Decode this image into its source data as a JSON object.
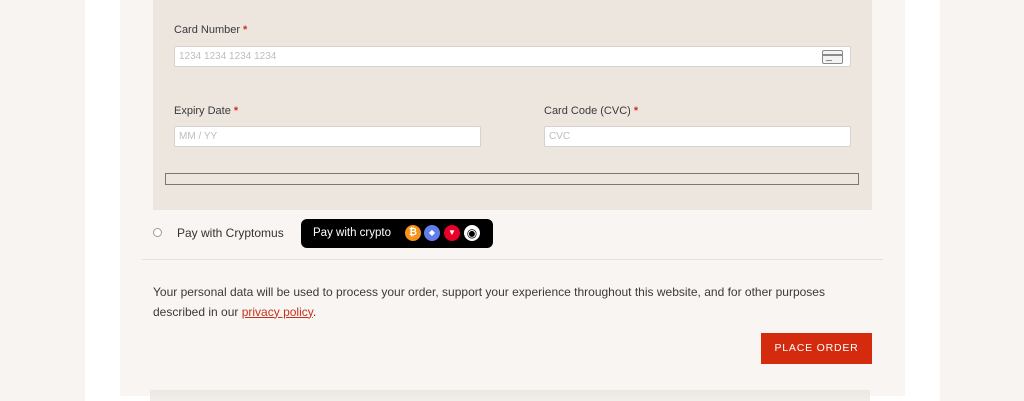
{
  "payment_form": {
    "card_number": {
      "label": "Card Number",
      "required_mark": "*",
      "placeholder": "1234 1234 1234 1234"
    },
    "expiry_date": {
      "label": "Expiry Date",
      "required_mark": "*",
      "placeholder": "MM / YY"
    },
    "card_code": {
      "label": "Card Code (CVC)",
      "required_mark": "*",
      "placeholder": "CVC"
    },
    "card_icon": "credit-card-icon"
  },
  "cryptomus": {
    "label": "Pay with Cryptomus",
    "badge_text": "Pay with crypto",
    "coins": [
      {
        "name": "bitcoin-icon",
        "glyph": "₿",
        "color": "#f7931a"
      },
      {
        "name": "ethereum-icon",
        "glyph": "◆",
        "color": "#627eea"
      },
      {
        "name": "tron-icon",
        "glyph": "▼",
        "color": "#eb0029"
      },
      {
        "name": "cryptomus-icon",
        "glyph": "◉",
        "color": "#ffffff"
      }
    ]
  },
  "privacy": {
    "text_before": "Your personal data will be used to process your order, support your experience throughout this website, and for other purposes described in our ",
    "link_text": "privacy policy",
    "text_after": "."
  },
  "place_order_label": "PLACE ORDER",
  "colors": {
    "accent": "#d42a0e",
    "form_bg": "#ede6df",
    "badge_bg": "#000000"
  }
}
